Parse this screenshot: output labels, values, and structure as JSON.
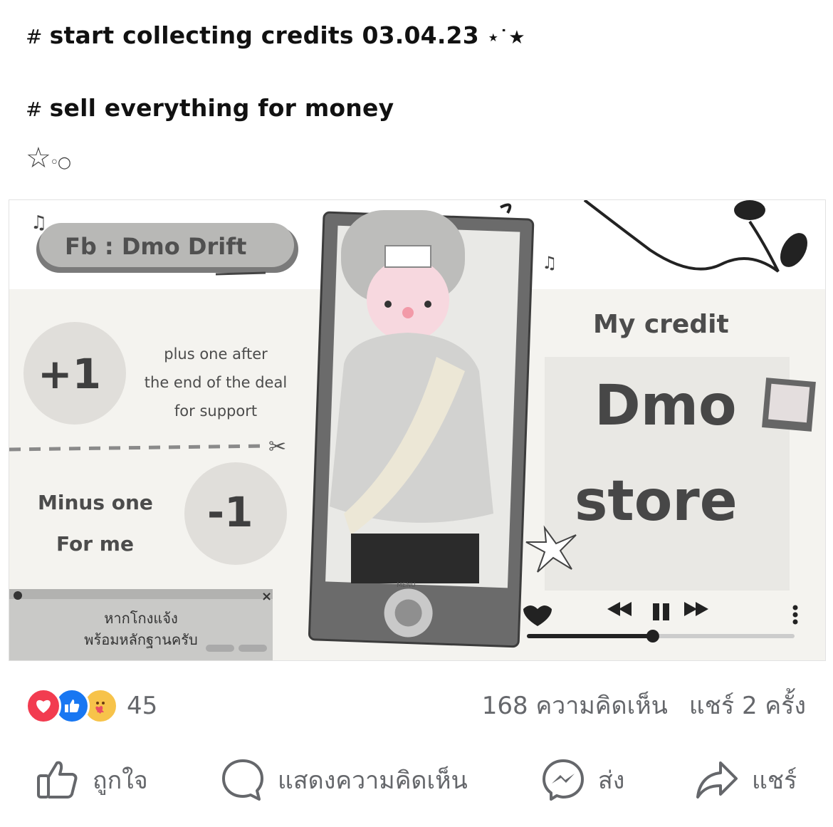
{
  "post": {
    "line1_hash": "#",
    "line1_text": "start collecting credits 03.04.23",
    "line1_deco": "⋆˙★",
    "line2_hash": "#",
    "line2_text": "sell everything for money",
    "deco_star": "☆",
    "deco_circles": "◦○"
  },
  "artwork": {
    "fb_label": "Fb : Dmo Drift",
    "plus_badge": "+1",
    "plus_line1": "plus one after",
    "plus_line2": "the end of the deal",
    "plus_line3": "for support",
    "minus_line1": "Minus one",
    "minus_line2": "For me",
    "minus_badge": "-1",
    "notice_line1": "หากโกงแจ้ง",
    "notice_line2": "พร้อมหลักฐานครับ",
    "notice_close": "×",
    "credit_label": "My credit",
    "store_line1": "Dmo",
    "store_line2": "store",
    "player_menu": "MENU",
    "progress": 0.47
  },
  "reactions": {
    "count": "45",
    "icons": [
      "love-icon",
      "like-icon",
      "care-icon"
    ]
  },
  "stats": {
    "comments": "168 ความคิดเห็น",
    "shares": "แชร์ 2 ครั้ง"
  },
  "actions": {
    "like": "ถูกใจ",
    "comment": "แสดงความคิดเห็น",
    "send": "ส่ง",
    "share": "แชร์"
  },
  "colors": {
    "muted_text": "#65676b",
    "love": "#f23c50",
    "like": "#1877f2",
    "care": "#f7c34a"
  }
}
